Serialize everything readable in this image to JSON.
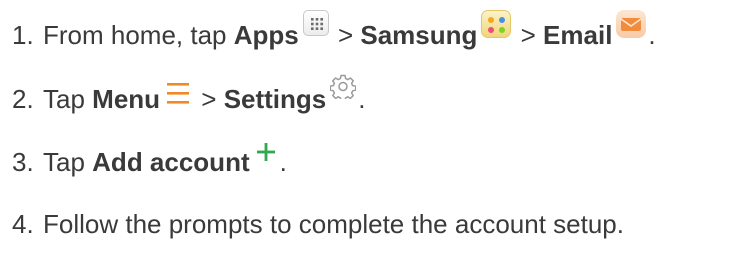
{
  "steps": [
    {
      "number": "1.",
      "text_before": "From home, tap ",
      "apps_label": "Apps",
      "sep1": " > ",
      "samsung_label": "Samsung",
      "sep2": " > ",
      "email_label": "Email",
      "end": "."
    },
    {
      "number": "2.",
      "text_before": "Tap ",
      "menu_label": "Menu",
      "sep1": " > ",
      "settings_label": "Settings",
      "end": "."
    },
    {
      "number": "3.",
      "text_before": "Tap ",
      "add_account_label": "Add account",
      "end": "."
    },
    {
      "number": "4.",
      "text": "Follow the prompts to complete the account setup."
    }
  ],
  "icons": {
    "apps": "apps-grid-icon",
    "samsung": "samsung-folder-icon",
    "email": "email-envelope-icon",
    "menu": "menu-lines-icon",
    "settings": "gear-icon",
    "add": "plus-icon"
  },
  "colors": {
    "text": "#3a3a3a",
    "menu_orange": "#f28a24",
    "plus_green": "#2fa84f",
    "email_orange": "#f08c3c",
    "gear_gray": "#9a9a9a"
  }
}
